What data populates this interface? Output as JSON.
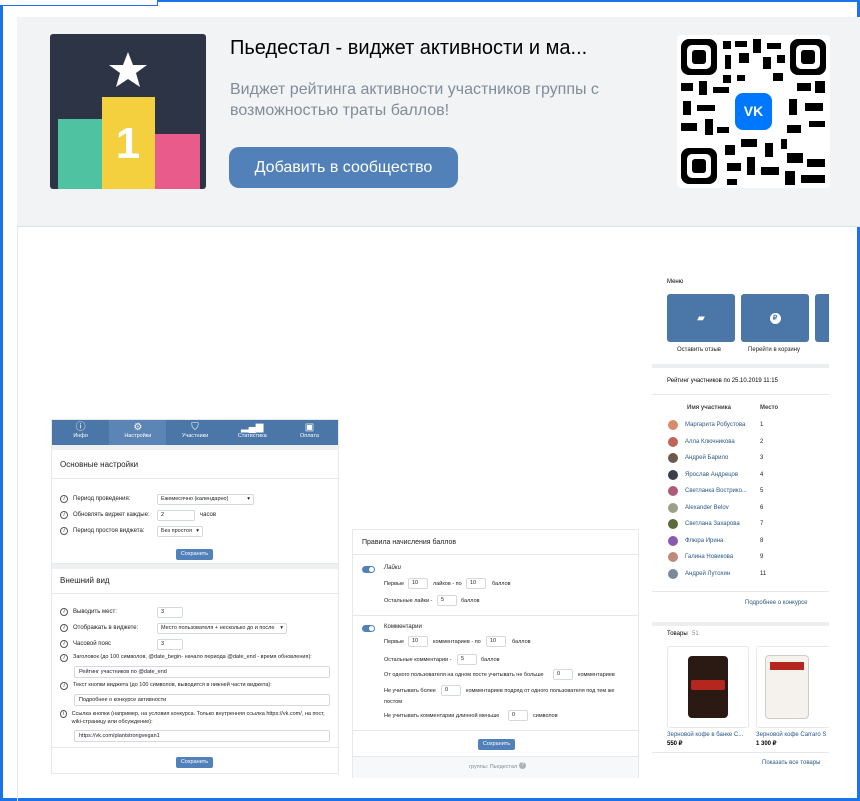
{
  "app": {
    "title": "Пьедестал - виджет активности и ма...",
    "description": "Виджет рейтинга активности участников группы с возможностью траты баллов!",
    "add_button": "Добавить в сообщество",
    "icon_digit": "1",
    "qr_badge": "VK"
  },
  "settings": {
    "tabs": [
      {
        "label": "Инфо",
        "icon": "info-icon"
      },
      {
        "label": "Настройки",
        "icon": "gear-icon"
      },
      {
        "label": "Участники",
        "icon": "shield-icon"
      },
      {
        "label": "Статистика",
        "icon": "chart-icon"
      },
      {
        "label": "Оплата",
        "icon": "wallet-icon"
      }
    ],
    "main_title": "Основные настройки",
    "period_label": "Период проведения:",
    "period_value": "Ежемесячно (календарно)",
    "update_label": "Обновлять виджет каждые:",
    "update_value": "2",
    "update_unit": "часов",
    "idle_label": "Период простоя виджета:",
    "idle_value": "Без простоя",
    "save": "Сохранить",
    "look_title": "Внешний вид",
    "places_label": "Выводить мест:",
    "places_value": "3",
    "display_label": "Отображать в виджете:",
    "display_value": "Место пользователя + несколько до и после",
    "tz_label": "Часовой пояс",
    "tz_value": "3",
    "header_hint": "Заголовок (до 100 символов, @date_begin- начало периода @date_end - время обновления):",
    "header_value": "Рейтинг участников по @date_end",
    "btn_hint": "Текст кнопки виджета (до 100 символов, выводится в нижней части виджета):",
    "btn_value": "Подробнее о конкурсе активности",
    "link_hint": "Ссылка кнопки (например, на условия конкурса. Только внутренняя ссылка https://vk.com/, на пост, wiki-страницу или обсуждение):",
    "link_value": "https://vk.com/plantstrongvegan1"
  },
  "rules": {
    "title": "Правила начисления баллов",
    "likes_label": "Лайки",
    "first": "Первые",
    "likes_n": "10",
    "likes_per": "лайков - по",
    "likes_pts": "10",
    "points": "баллов",
    "other_likes": "Остальные лайки -",
    "other_likes_pts": "5",
    "comments_label": "Комментарии",
    "comm_n": "10",
    "comm_per": "комментариев - по",
    "comm_pts": "10",
    "other_comm": "Остальные комментарии -",
    "other_comm_pts": "5",
    "per_post": "От одного пользователя на одном посте учитывать не больше",
    "per_post_value": "0",
    "per_post_unit": "комментариев",
    "ignore_more": "Не учитывать более",
    "ignore_more_value": "0",
    "ignore_more_tail": "комментариев подряд от одного пользователя под тем же",
    "ignore_more_tail2": "постом",
    "ignore_short": "Не учитывать комментарии длинной меньше",
    "ignore_short_value": "0",
    "ignore_short_unit": "символов",
    "save": "Сохранить",
    "footer": "группы: Пьедестал"
  },
  "preview": {
    "menu_title": "Меню",
    "menu_items": [
      "Оставить отзыв",
      "Перейти в корзину"
    ],
    "rating_title": "Рейтинг участников по 25.10.2019 11:15",
    "col_name": "Имя участника",
    "col_place": "Место",
    "members": [
      {
        "name": "Маргарита Робустова",
        "place": "1",
        "color": "#d98a6a"
      },
      {
        "name": "Алла Ключникова",
        "place": "2",
        "color": "#c0645a"
      },
      {
        "name": "Андрей Барило",
        "place": "3",
        "color": "#6b5a4a"
      },
      {
        "name": "Ярослав Андрецов",
        "place": "4",
        "color": "#3a3f4a"
      },
      {
        "name": "Светланка Вострико...",
        "place": "5",
        "color": "#b05a78"
      },
      {
        "name": "Alexander Belov",
        "place": "6",
        "color": "#9aa08a"
      },
      {
        "name": "Светлана Захарова",
        "place": "7",
        "color": "#5a6a3a"
      },
      {
        "name": "Флюра Ирина",
        "place": "8",
        "color": "#8a5ab0"
      },
      {
        "name": "Галина Новикова",
        "place": "9",
        "color": "#c08a7a"
      },
      {
        "name": "Андрей Лутохин",
        "place": "11",
        "color": "#7a8a9a"
      }
    ],
    "more_link": "Подробнее о конкурсе",
    "goods_title": "Товары",
    "goods_count": "51",
    "goods": [
      {
        "name": "Зерновой кофе в банке С...",
        "price": "550 ₽"
      },
      {
        "name": "Зерновой кофе Carraro S",
        "price": "1 300 ₽"
      }
    ],
    "show_all": "Показать все товары"
  }
}
